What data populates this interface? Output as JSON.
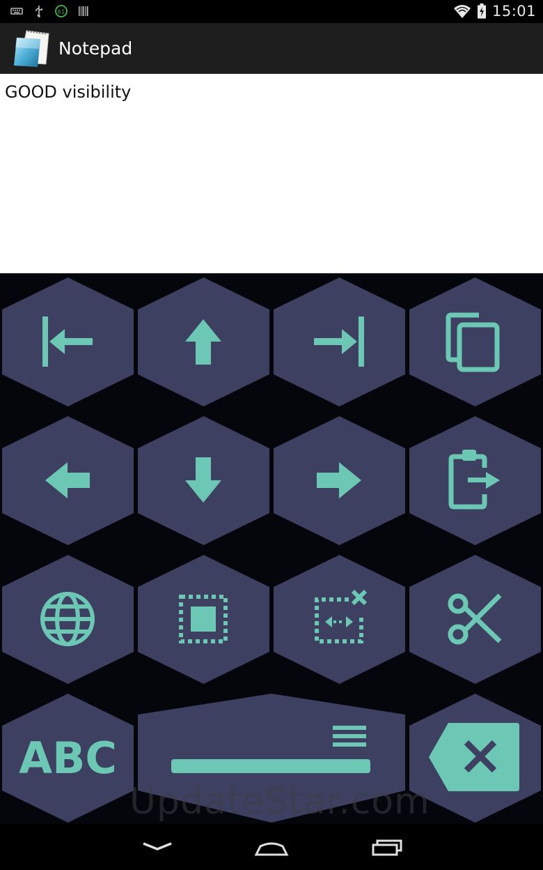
{
  "status_bar": {
    "time": "15:01",
    "badge": "61",
    "icons": [
      "keyboard-icon",
      "usb-icon",
      "badge-icon",
      "barcode-icon",
      "wifi-icon",
      "battery-icon"
    ]
  },
  "action_bar": {
    "title": "Notepad",
    "icon": "notepad-icon"
  },
  "editor": {
    "text": "GOOD visibility"
  },
  "keyboard": {
    "colors": {
      "key": "#3d4060",
      "glyph": "#6cc8b4",
      "background": "#05050c"
    },
    "rows": [
      [
        "home-arrow-key",
        "up-arrow-key",
        "end-arrow-key",
        "copy-key"
      ],
      [
        "left-arrow-key",
        "down-arrow-key",
        "right-arrow-key",
        "paste-key"
      ],
      [
        "language-key",
        "select-all-key",
        "deselect-key",
        "cut-key"
      ],
      [
        "abc-key",
        "space-key",
        "backspace-key"
      ]
    ],
    "abc_label": "ABC"
  },
  "watermark": "UpdateStar.com",
  "nav_bar": {
    "buttons": [
      "back-icon",
      "home-icon",
      "recents-icon"
    ]
  }
}
